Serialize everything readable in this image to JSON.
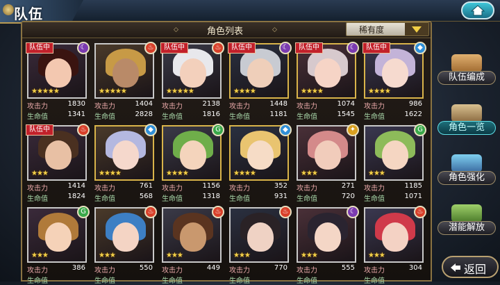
{
  "header": {
    "title": "队伍"
  },
  "panel": {
    "title": "角色列表",
    "sort_label": "稀有度"
  },
  "labels": {
    "atk": "攻击力",
    "hp": "生命值",
    "party": "队伍中"
  },
  "side_menu": [
    {
      "label": "队伍编成",
      "icon": "party-portraits-icon"
    },
    {
      "label": "角色一览",
      "icon": "book-icon",
      "active": true
    },
    {
      "label": "角色强化",
      "icon": "crystal-icon"
    },
    {
      "label": "潜能解放",
      "icon": "orb-icon"
    }
  ],
  "back": {
    "label": "返回"
  },
  "characters": [
    {
      "in_party": true,
      "element": "dark",
      "stars": 5,
      "frame": "silver",
      "atk": "1830",
      "hp": "1341",
      "hair": "#3a1410",
      "skin": "#f3c8b0"
    },
    {
      "in_party": false,
      "element": "fire",
      "stars": 5,
      "frame": "silver",
      "atk": "1404",
      "hp": "2828",
      "hair": "#c79a46",
      "skin": "#b98a68"
    },
    {
      "in_party": true,
      "element": "fire",
      "stars": 5,
      "frame": "silver",
      "atk": "2138",
      "hp": "1816",
      "hair": "#e8e8ec",
      "skin": "#f3d0bc"
    },
    {
      "in_party": true,
      "element": "dark",
      "stars": 4,
      "frame": "gold",
      "atk": "1448",
      "hp": "1181",
      "hair": "#c8cbd2",
      "skin": "#efcfba"
    },
    {
      "in_party": true,
      "element": "dark",
      "stars": 4,
      "frame": "gold",
      "atk": "1074",
      "hp": "1545",
      "hair": "#d7c9cd",
      "skin": "#f6d4c6"
    },
    {
      "in_party": true,
      "element": "water",
      "stars": 4,
      "frame": "gold",
      "atk": "986",
      "hp": "1622",
      "hair": "#c3b3d8",
      "skin": "#f6dacf"
    },
    {
      "in_party": true,
      "element": "fire",
      "stars": 3,
      "frame": "silver",
      "atk": "1414",
      "hp": "1824",
      "hair": "#4a3020",
      "skin": "#e8c0a4"
    },
    {
      "in_party": false,
      "element": "water",
      "stars": 4,
      "frame": "gold",
      "atk": "761",
      "hp": "568",
      "hair": "#b4b8e0",
      "skin": "#f5d8cc"
    },
    {
      "in_party": false,
      "element": "wind",
      "stars": 4,
      "frame": "gold",
      "atk": "1156",
      "hp": "1318",
      "hair": "#6fae4a",
      "skin": "#f4d4bc"
    },
    {
      "in_party": false,
      "element": "water",
      "stars": 4,
      "frame": "gold",
      "atk": "352",
      "hp": "931",
      "hair": "#e9c470",
      "skin": "#f6dcc6"
    },
    {
      "in_party": false,
      "element": "light",
      "stars": 3,
      "frame": "silver",
      "atk": "271",
      "hp": "720",
      "hair": "#d48a8a",
      "skin": "#f1ccbb"
    },
    {
      "in_party": false,
      "element": "wind",
      "stars": 3,
      "frame": "silver",
      "atk": "1185",
      "hp": "1071",
      "hair": "#8dbb5a",
      "skin": "#f5d6c2"
    },
    {
      "in_party": false,
      "element": "wind",
      "stars": 3,
      "frame": "silver",
      "atk": "386",
      "hp": "",
      "hair": "#b07a3a",
      "skin": "#f5d2b8"
    },
    {
      "in_party": false,
      "element": "fire",
      "stars": 3,
      "frame": "silver",
      "atk": "550",
      "hp": "",
      "hair": "#3d7fc4",
      "skin": "#f4d4c4"
    },
    {
      "in_party": false,
      "element": "fire",
      "stars": 3,
      "frame": "silver",
      "atk": "449",
      "hp": "",
      "hair": "#5a3420",
      "skin": "#c9986e"
    },
    {
      "in_party": false,
      "element": "fire",
      "stars": 3,
      "frame": "silver",
      "atk": "770",
      "hp": "",
      "hair": "#2a2226",
      "skin": "#efd2c4"
    },
    {
      "in_party": false,
      "element": "dark",
      "stars": 3,
      "frame": "silver",
      "atk": "555",
      "hp": "",
      "hair": "#2a2430",
      "skin": "#f4d6c6"
    },
    {
      "in_party": false,
      "element": "fire",
      "stars": 3,
      "frame": "silver",
      "atk": "304",
      "hp": "",
      "hair": "#d03a4a",
      "skin": "#f4d2c4"
    }
  ],
  "element_colors": {
    "dark": "#7b3bb0",
    "fire": "#d8402a",
    "water": "#2f8fd8",
    "wind": "#3aa84a",
    "light": "#d9a020"
  },
  "element_glyphs": {
    "dark": "☾",
    "fire": "♨",
    "water": "◆",
    "wind": "G",
    "light": "✦"
  }
}
